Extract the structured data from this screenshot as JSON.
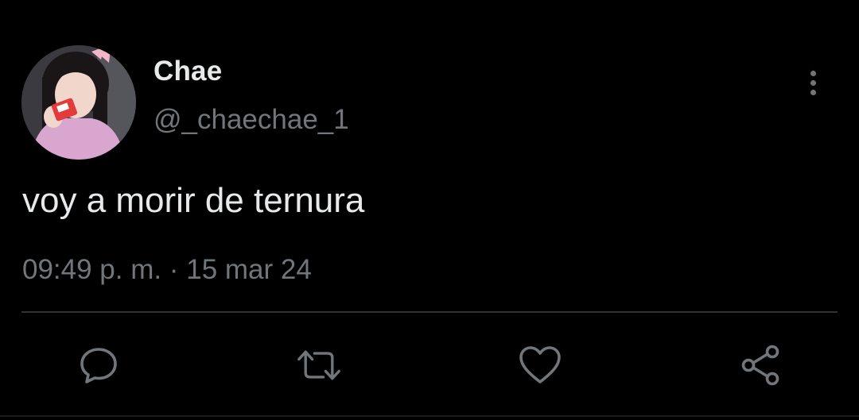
{
  "tweet": {
    "author": {
      "display_name": "Chae",
      "handle": "@_chaechae_1",
      "avatar_icon": "profile-photo"
    },
    "text": "voy a morir de ternura",
    "time": "09:49 p. m.",
    "separator": "·",
    "date": "15 mar 24",
    "more_icon": "more-vertical-icon",
    "actions": [
      {
        "name": "reply",
        "icon": "comment-bubble-icon"
      },
      {
        "name": "retweet",
        "icon": "retweet-arrows-icon"
      },
      {
        "name": "like",
        "icon": "heart-icon"
      },
      {
        "name": "share",
        "icon": "share-nodes-icon"
      }
    ]
  },
  "colors": {
    "background": "#000000",
    "primary_text": "#e7e9ea",
    "secondary_text": "#71767b",
    "divider": "#2f3336"
  }
}
